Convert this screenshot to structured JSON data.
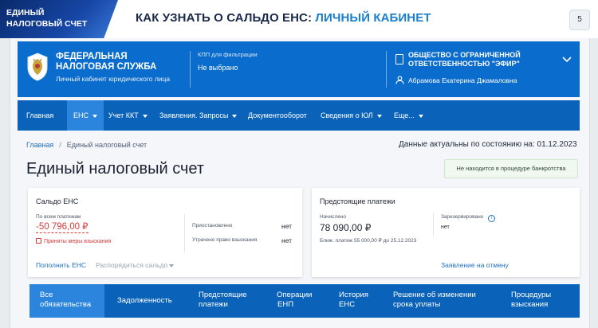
{
  "slide": {
    "badge": [
      "ЕДИНЫЙ",
      "НАЛОГОВЫЙ СЧЕТ"
    ],
    "title_prefix": "КАК УЗНАТЬ О САЛЬДО ЕНС: ",
    "title_accent": "ЛИЧНЫЙ КАБИНЕТ",
    "page_number": "5"
  },
  "site_header": {
    "agency_line1": "ФЕДЕРАЛЬНАЯ",
    "agency_line2": "НАЛОГОВАЯ СЛУЖБА",
    "subtitle": "Личный кабинет юридического лица",
    "kpp_label": "КПП для фильтрации",
    "kpp_value": "Не выбрано",
    "org_line1": "ОБЩЕСТВО С ОГРАНИЧЕННОЙ",
    "org_line2": "ОТВЕТСТВЕННОСТЬЮ \"ЭФИР\"",
    "user": "Абрамова Екатерина Джамаловна"
  },
  "nav": {
    "items": [
      {
        "label": "Главная",
        "dropdown": false
      },
      {
        "label": "ЕНС",
        "dropdown": true,
        "active": true
      },
      {
        "label": "Учет ККТ",
        "dropdown": true
      },
      {
        "label": "Заявления. Запросы",
        "dropdown": true
      },
      {
        "label": "Документооборот",
        "dropdown": false
      },
      {
        "label": "Сведения о ЮЛ",
        "dropdown": true
      },
      {
        "label": "Еще...",
        "dropdown": true
      }
    ]
  },
  "breadcrumb": {
    "home": "Главная",
    "separator": "/",
    "current": "Единый налоговый счет"
  },
  "actual_date": "Данные актуальны по состоянию на: 01.12.2023",
  "page_title": "Единый налоговый счет",
  "bankruptcy_status": "Не находится в процедуре банкротства",
  "saldo_card": {
    "title": "Сальдо ЕНС",
    "all_payments_label": "По всем платежам",
    "all_payments_value": "-50 796,00 ₽",
    "measures_label": "Приняты меры взыскания",
    "suspended_label": "Приостановлено",
    "suspended_value": "нет",
    "lost_right_label": "Утрачено право взыскания",
    "lost_right_value": "нет",
    "replenish_link": "Пополнить ЕНС",
    "dispose_link": "Распорядиться сальдо"
  },
  "upcoming_card": {
    "title": "Предстоящие платежи",
    "accrued_label": "Начислено",
    "accrued_value": "78 090,00 ₽",
    "reserved_label": "Зарезервировано",
    "reserved_value": "нет",
    "nearest_payment": "Ближ. платеж 55 000,00 ₽ до 25.12.2023",
    "cancel_link": "Заявление на отмену"
  },
  "tabs": [
    {
      "label": [
        "Все",
        "обязательства"
      ],
      "active": true
    },
    {
      "label": [
        "Задолженность"
      ]
    },
    {
      "label": [
        "Предстоящие",
        "платежи"
      ]
    },
    {
      "label": [
        "Операции",
        "ЕНП"
      ]
    },
    {
      "label": [
        "История",
        "ЕНС"
      ]
    },
    {
      "label": [
        "Решение об изменении",
        "срока уплаты"
      ]
    },
    {
      "label": [
        "Процедуры",
        "взыскания"
      ]
    }
  ],
  "colors": {
    "header_blue": "#0a6ccd",
    "nav_blue": "#0b63b9",
    "active_blue": "#2c85dd",
    "negative_red": "#d33a3a",
    "link_blue": "#1f6fc1"
  },
  "icons": [
    "fns-emblem-icon",
    "organization-icon",
    "user-icon",
    "chevron-down-icon",
    "warning-icon",
    "info-icon"
  ]
}
